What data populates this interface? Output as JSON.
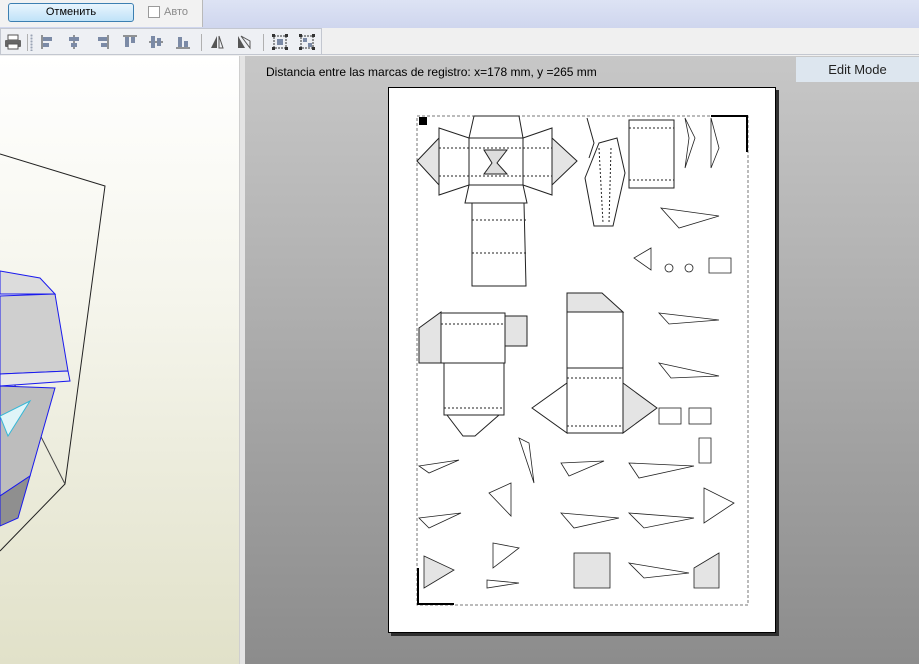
{
  "top_bar": {
    "cancel_label": "Отменить",
    "auto_label": "Авто",
    "auto_checked": false
  },
  "toolbar": {
    "icons": [
      "print-icon",
      "align-left-icon",
      "align-center-h-icon",
      "align-right-icon",
      "align-top-icon",
      "align-center-v-icon",
      "align-bottom-icon",
      "flip-horizontal-icon",
      "flip-vertical-icon",
      "group-icon",
      "ungroup-icon"
    ]
  },
  "print_preview": {
    "registration_text": "Distancia entre las marcas de registro: x=178 mm, y =265 mm",
    "mode_badge": "Edit Mode"
  }
}
